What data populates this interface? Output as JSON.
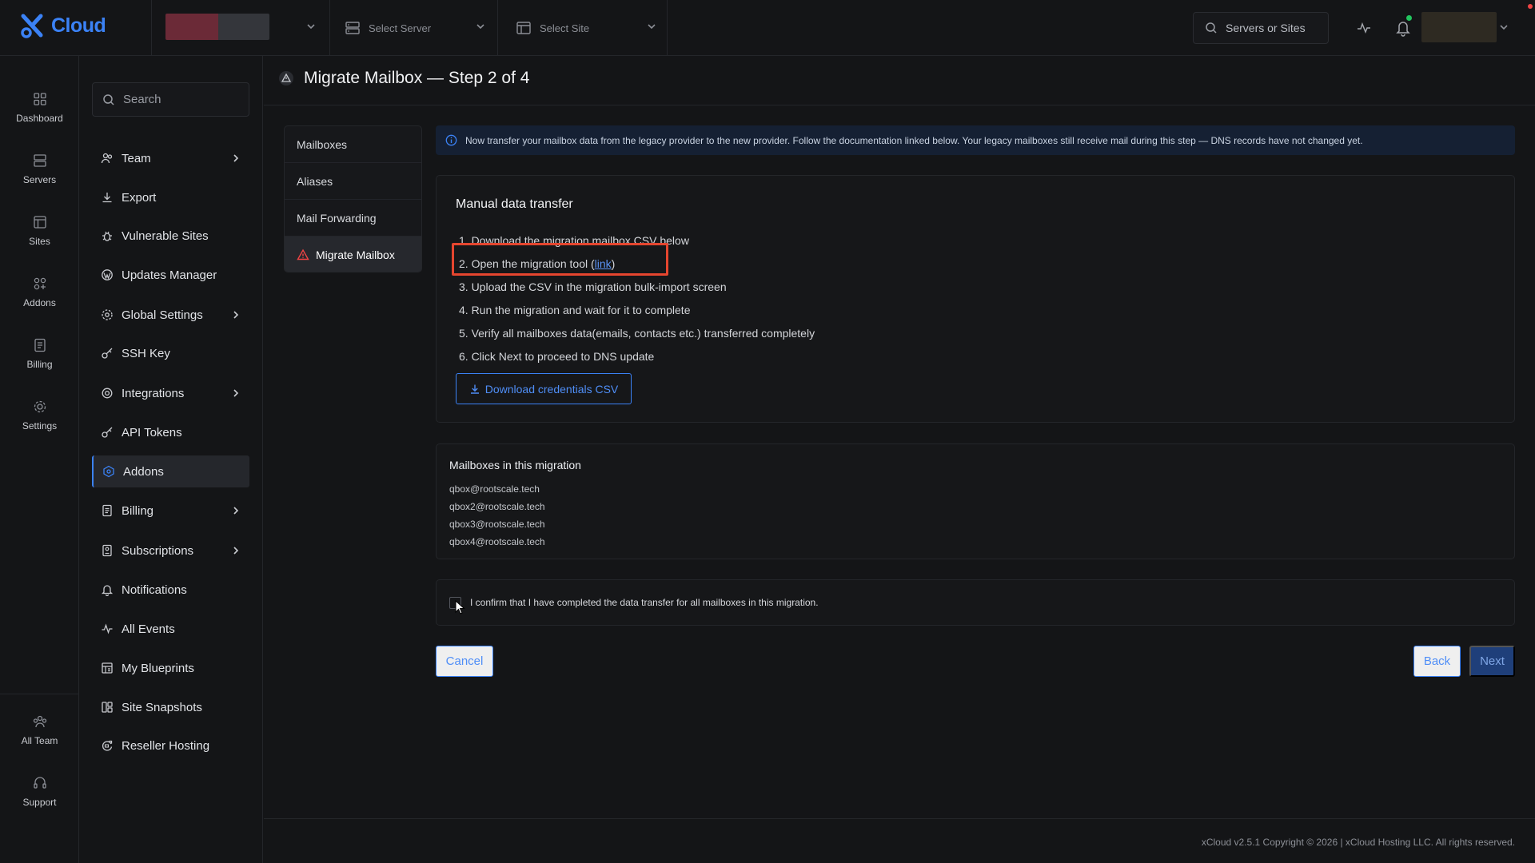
{
  "brand": {
    "logo_text": "Cloud",
    "accent": "#3b82f6"
  },
  "topbar": {
    "select_server": "Select Server",
    "select_site": "Select Site",
    "search_placeholder": "Servers or Sites",
    "status_dot_color": "#22c55e",
    "alert_dot_color": "#ef4444"
  },
  "rail": {
    "items": [
      {
        "label": "Dashboard",
        "icon": "grid-icon"
      },
      {
        "label": "Servers",
        "icon": "server-icon"
      },
      {
        "label": "Sites",
        "icon": "browser-icon"
      },
      {
        "label": "Addons",
        "icon": "addons-icon"
      },
      {
        "label": "Billing",
        "icon": "invoice-icon"
      },
      {
        "label": "Settings",
        "icon": "gear-icon"
      }
    ],
    "bottom": [
      {
        "label": "All Team",
        "icon": "team-icon"
      },
      {
        "label": "Support",
        "icon": "headset-icon"
      }
    ]
  },
  "sidenav": {
    "search_placeholder": "Search",
    "items": [
      {
        "label": "Team",
        "icon": "users-icon",
        "chevron": true
      },
      {
        "label": "Export",
        "icon": "download-icon",
        "chevron": false
      },
      {
        "label": "Vulnerable Sites",
        "icon": "bug-icon",
        "chevron": false
      },
      {
        "label": "Updates Manager",
        "icon": "wordpress-icon",
        "chevron": false
      },
      {
        "label": "Global Settings",
        "icon": "globe-gear-icon",
        "chevron": true
      },
      {
        "label": "SSH Key",
        "icon": "key-icon",
        "chevron": false
      },
      {
        "label": "Integrations",
        "icon": "cog-icon",
        "chevron": true
      },
      {
        "label": "API Tokens",
        "icon": "key-icon",
        "chevron": false
      },
      {
        "label": "Addons",
        "icon": "addon-icon",
        "chevron": false,
        "active": true
      },
      {
        "label": "Billing",
        "icon": "invoice-icon",
        "chevron": true
      },
      {
        "label": "Subscriptions",
        "icon": "subscription-icon",
        "chevron": true
      },
      {
        "label": "Notifications",
        "icon": "bell-icon",
        "chevron": false
      },
      {
        "label": "All Events",
        "icon": "activity-icon",
        "chevron": false
      },
      {
        "label": "My Blueprints",
        "icon": "blueprint-icon",
        "chevron": false
      },
      {
        "label": "Site Snapshots",
        "icon": "snapshot-icon",
        "chevron": false
      },
      {
        "label": "Reseller Hosting",
        "icon": "reseller-icon",
        "chevron": false
      }
    ]
  },
  "page": {
    "title": "Migrate Mailbox — Step 2 of 4",
    "subnav": [
      {
        "label": "Mailboxes"
      },
      {
        "label": "Aliases"
      },
      {
        "label": "Mail Forwarding"
      },
      {
        "label": "Migrate Mailbox",
        "active": true
      }
    ],
    "info": "Now transfer your mailbox data from the legacy provider to the new provider. Follow the documentation linked below. Your legacy mailboxes still receive mail during this step — DNS records have not changed yet.",
    "manual": {
      "title": "Manual data transfer",
      "steps": [
        "1. Download the migration mailbox CSV below",
        "2. Open the migration tool (",
        "3. Upload the CSV in the migration bulk-import screen",
        "4. Run the migration and wait for it to complete",
        "5. Verify all mailboxes data(emails, contacts etc.) transferred completely",
        "6. Click Next to proceed to DNS update"
      ],
      "link_text": "link",
      "step2_suffix": ")",
      "download_label": "Download credentials CSV"
    },
    "mailboxes": {
      "title": "Mailboxes in this migration",
      "items": [
        "qbox@rootscale.tech",
        "qbox2@rootscale.tech",
        "qbox3@rootscale.tech",
        "qbox4@rootscale.tech"
      ]
    },
    "confirm_text": "I confirm that I have completed the data transfer for all mailboxes in this migration.",
    "buttons": {
      "cancel": "Cancel",
      "back": "Back",
      "next": "Next"
    }
  },
  "footer": {
    "text": "xCloud v2.5.1 Copyright © 2026 | xCloud Hosting LLC. All rights reserved."
  }
}
